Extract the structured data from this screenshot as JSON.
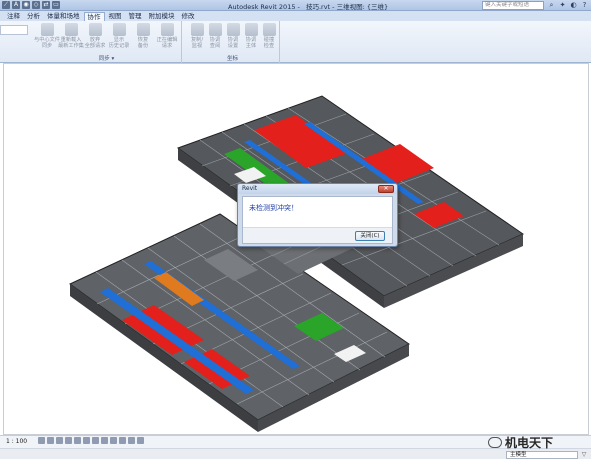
{
  "window": {
    "app_title": "Autodesk Revit 2015 -",
    "file_name": "技巧.rvt - 三维视图: {三维}",
    "search_placeholder": "键入关键字或短语"
  },
  "tabs": [
    {
      "label": "注释"
    },
    {
      "label": "分析"
    },
    {
      "label": "体量和场地"
    },
    {
      "label": "协作",
      "active": true
    },
    {
      "label": "视图"
    },
    {
      "label": "管理"
    },
    {
      "label": "附加模块"
    },
    {
      "label": "修改"
    }
  ],
  "ribbon": {
    "sync_group": {
      "label": "同步 ▾",
      "buttons": [
        {
          "label": "与中心文件\n同步"
        },
        {
          "label": "重新载入\n最新工作集"
        },
        {
          "label": "放弃\n全部请求"
        },
        {
          "label": "显示\n历史记录"
        },
        {
          "label": "恢复\n备份"
        },
        {
          "label": "正在编辑\n请求"
        }
      ]
    },
    "coord_group": {
      "label": "坐标",
      "buttons": [
        {
          "label": "复制/\n监视"
        },
        {
          "label": "协调\n查阅"
        },
        {
          "label": "协调\n设置"
        },
        {
          "label": "协调\n主体"
        },
        {
          "label": "碰撞\n检查"
        }
      ]
    }
  },
  "dialog": {
    "title": "Revit",
    "message": "未检测到冲突！",
    "close_button": "关闭(C)"
  },
  "statusbar": {
    "scale": "1 : 100",
    "model_selector": "主模型",
    "watermark": "机电天下"
  },
  "colors": {
    "ribbon_bg": "#dfe8f4",
    "accent_red": "#e3201b",
    "accent_blue": "#1f6fd6",
    "accent_green": "#2aa52a",
    "accent_orange": "#e07a1f",
    "structure_gray": "#5f6266"
  },
  "icons": {
    "dialog_close": "close-icon",
    "filter": "filter-icon"
  }
}
